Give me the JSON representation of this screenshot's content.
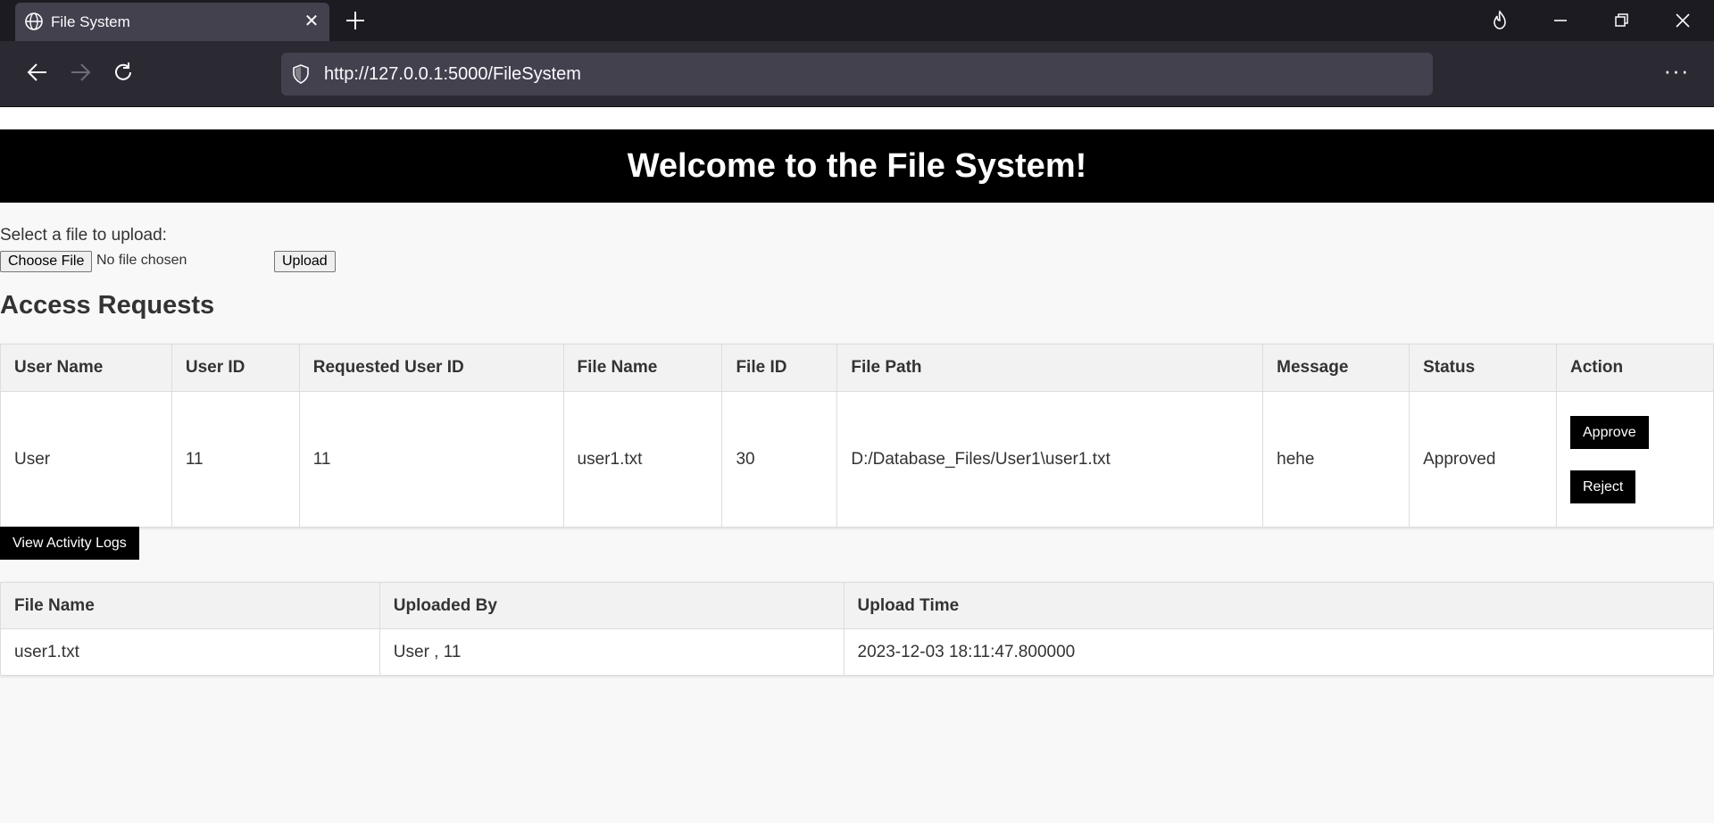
{
  "browser": {
    "tab_title": "File System",
    "tab_close": "✕",
    "url": "http://127.0.0.1:5000/FileSystem",
    "menu": "···"
  },
  "page": {
    "heading": "Welcome to the File System!",
    "upload": {
      "label": "Select a file to upload:",
      "choose_button": "Choose File",
      "no_file_text": "No file chosen",
      "upload_button": "Upload"
    },
    "access_requests": {
      "title": "Access Requests",
      "columns": [
        "User Name",
        "User ID",
        "Requested User ID",
        "File Name",
        "File ID",
        "File Path",
        "Message",
        "Status",
        "Action"
      ],
      "rows": [
        {
          "user_name": "User",
          "user_id": "11",
          "requested_user_id": "11",
          "file_name": "user1.txt",
          "file_id": "30",
          "file_path": "D:/Database_Files/User1\\user1.txt",
          "message": "hehe",
          "status": "Approved",
          "approve_label": "Approve",
          "reject_label": "Reject"
        }
      ]
    },
    "view_logs_button": "View Activity Logs",
    "uploads": {
      "columns": [
        "File Name",
        "Uploaded By",
        "Upload Time"
      ],
      "rows": [
        {
          "file_name": "user1.txt",
          "uploaded_by": "User , 11",
          "upload_time": "2023-12-03 18:11:47.800000"
        }
      ]
    }
  }
}
